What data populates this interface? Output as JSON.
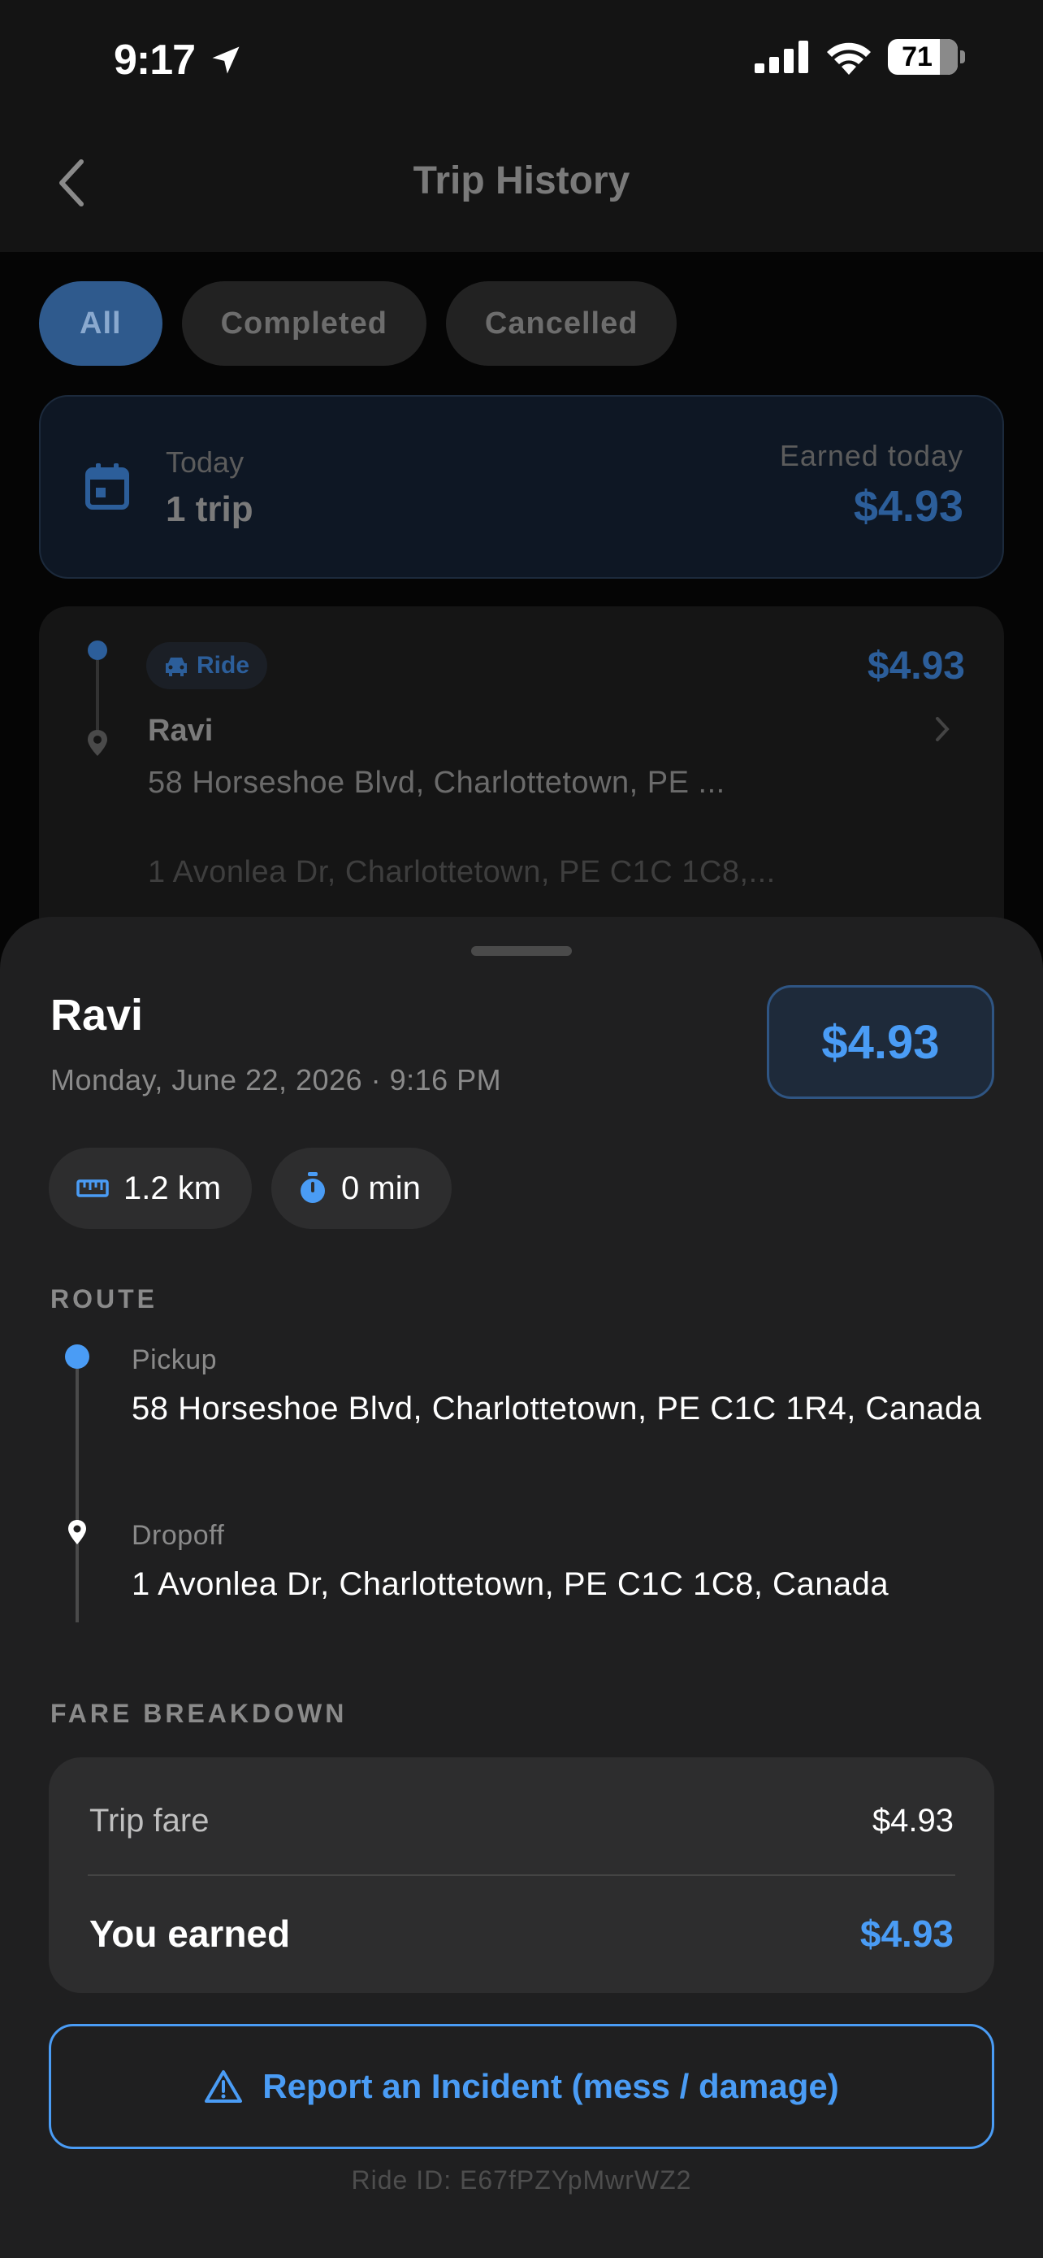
{
  "status_bar": {
    "time": "9:17",
    "battery": "71"
  },
  "navbar": {
    "title": "Trip History"
  },
  "filters": [
    {
      "label": "All",
      "active": true
    },
    {
      "label": "Completed",
      "active": false
    },
    {
      "label": "Cancelled",
      "active": false
    }
  ],
  "today_card": {
    "label": "Today",
    "count": "1 trip",
    "earned_label": "Earned today",
    "earned_value": "$4.93"
  },
  "trip_card": {
    "badge": "Ride",
    "price": "$4.93",
    "name": "Ravi",
    "pickup": "58 Horseshoe Blvd, Charlottetown, PE ...",
    "dropoff": "1 Avonlea Dr, Charlottetown, PE C1C 1C8,..."
  },
  "sheet": {
    "name": "Ravi",
    "datetime": "Monday, June 22, 2026 · 9:16 PM",
    "fare": "$4.93",
    "distance": "1.2 km",
    "duration": "0 min",
    "route_label": "ROUTE",
    "pickup_label": "Pickup",
    "pickup_address": "58 Horseshoe Blvd, Charlottetown, PE C1C 1R4, Canada",
    "dropoff_label": "Dropoff",
    "dropoff_address": "1 Avonlea Dr, Charlottetown, PE C1C 1C8, Canada",
    "fare_breakdown_label": "FARE BREAKDOWN",
    "trip_fare_label": "Trip fare",
    "trip_fare_value": "$4.93",
    "earned_label": "You earned",
    "earned_value": "$4.93",
    "report_button": "Report an Incident (mess / damage)",
    "ride_id": "Ride ID: E67fPZYpMwrWZ2"
  },
  "colors": {
    "accent": "#4a9cf5",
    "sheet_bg": "#1f1f20",
    "card_bg": "#2d2d2e"
  }
}
